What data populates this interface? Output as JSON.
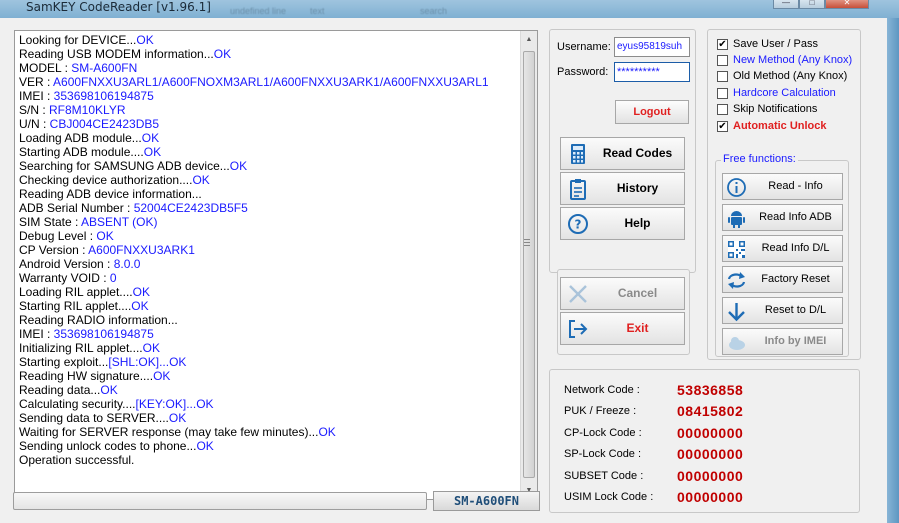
{
  "window": {
    "title": "SamKEY CodeReader [v1.96.1]",
    "blur_1": "undefined line",
    "blur_2": "text",
    "blur_3": "search",
    "minimize": "—",
    "maximize": "□",
    "close": "✕"
  },
  "log": {
    "lines": [
      [
        "Looking for DEVICE...",
        "OK"
      ],
      [
        "Reading USB MODEM information...",
        "OK"
      ],
      [
        "MODEL  : ",
        "SM-A600FN"
      ],
      [
        "VER  : ",
        "A600FNXXU3ARL1/A600FNOXM3ARL1/A600FNXXU3ARK1/A600FNXXU3ARL1"
      ],
      [
        "IMEI : ",
        "353698106194875"
      ],
      [
        "S/N  : ",
        "RF8M10KLYR"
      ],
      [
        "U/N  : ",
        "CBJ004CE2423DB5"
      ],
      [
        "Loading ADB module...",
        "OK"
      ],
      [
        "Starting ADB module....",
        "OK"
      ],
      [
        "Searching for SAMSUNG ADB device...",
        "OK"
      ],
      [
        "Checking device authorization....",
        "OK"
      ],
      [
        "Reading ADB device information...",
        ""
      ],
      [
        "ADB Serial Number : ",
        "52004CE2423DB5F5"
      ],
      [
        "SIM State : ",
        "ABSENT (OK)"
      ],
      [
        "Debug Level : ",
        "OK"
      ],
      [
        "CP Version : ",
        "A600FNXXU3ARK1"
      ],
      [
        "Android Version : ",
        "8.0.0"
      ],
      [
        "Warranty VOID : ",
        "0"
      ],
      [
        "Loading RIL applet....",
        "OK"
      ],
      [
        "Starting RIL applet....",
        "OK"
      ],
      [
        "Reading RADIO information...",
        ""
      ],
      [
        "IMEI : ",
        "353698106194875"
      ],
      [
        "Initializing RIL applet....",
        "OK"
      ],
      [
        "Starting exploit...",
        "[SHL:OK]...OK"
      ],
      [
        "Reading HW signature....",
        "OK"
      ],
      [
        "Reading data...",
        "OK"
      ],
      [
        "Calculating security....",
        "[KEY:OK]...OK"
      ],
      [
        "Sending data to SERVER....",
        "OK"
      ],
      [
        "Waiting for SERVER response (may take few minutes)...",
        "OK"
      ],
      [
        "Sending unlock codes to phone...",
        "OK"
      ],
      [
        "Operation successful.",
        ""
      ]
    ]
  },
  "progress": {
    "fraction": 0.0
  },
  "model_badge": "SM-A600FN",
  "login": {
    "username_label": "Username:",
    "username_value": "eyus95819suh",
    "password_label": "Password:",
    "password_value": "**********",
    "logout_label": "Logout"
  },
  "main_buttons": {
    "read_codes": "Read Codes",
    "history": "History",
    "help": "Help",
    "cancel": "Cancel",
    "exit": "Exit"
  },
  "options": {
    "save_user": {
      "label": "Save User / Pass",
      "checked": true
    },
    "new_method": {
      "label": "New Method (Any Knox)",
      "checked": false
    },
    "old_method": {
      "label": "Old Method (Any Knox)",
      "checked": false
    },
    "hardcore": {
      "label": "Hardcore Calculation",
      "checked": false
    },
    "skip_notif": {
      "label": "Skip Notifications",
      "checked": false
    },
    "auto_unlock": {
      "label": "Automatic Unlock",
      "checked": true
    }
  },
  "free": {
    "legend": "Free functions:",
    "read_info": "Read - Info",
    "read_info_adb": "Read Info ADB",
    "read_info_dl": "Read Info D/L",
    "factory_reset": "Factory Reset",
    "reset_dl": "Reset to D/L",
    "info_imei": "Info by IMEI"
  },
  "codes": [
    {
      "label": "Network Code :",
      "value": "53836858"
    },
    {
      "label": "PUK / Freeze :",
      "value": "08415802"
    },
    {
      "label": "CP-Lock Code :",
      "value": "00000000"
    },
    {
      "label": "SP-Lock Code :",
      "value": "00000000"
    },
    {
      "label": "SUBSET Code :",
      "value": "00000000"
    },
    {
      "label": "USIM Lock Code :",
      "value": "00000000"
    }
  ],
  "colors": {
    "accent_blue": "#1a1aff",
    "accent_red": "#e02020",
    "code_red": "#c00000"
  }
}
